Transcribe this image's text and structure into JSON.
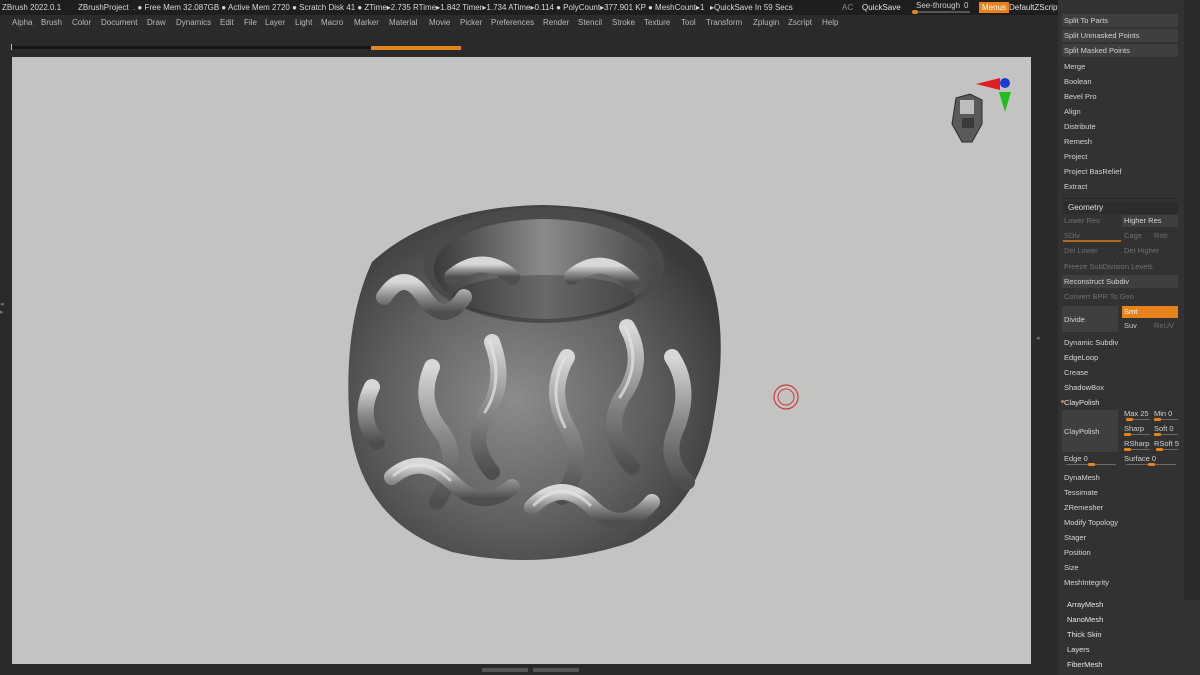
{
  "titlebar": {
    "app": "ZBrush 2022.0.1",
    "project": "ZBrushProject",
    "stats": ". ● Free Mem 32.087GB ● Active Mem 2720 ● Scratch Disk 41 ● ZTime▸2.735 RTime▸1.842 Timer▸1.734 ATime▸0.114 ● PolyCount▸377.901 KP ● MeshCount▸1",
    "quicksave_timer": "▸QuickSave In 59 Secs",
    "ac": "AC",
    "quicksave": "QuickSave",
    "see_through_label": "See-through",
    "see_through_value": "0",
    "menus": "Menus",
    "default_zscript": "DefaultZScript",
    "window_icons": "◆ ▤ ▣ ▢ — □ ✕"
  },
  "menu": [
    "Alpha",
    "Brush",
    "Color",
    "Document",
    "Draw",
    "Dynamics",
    "Edit",
    "File",
    "Layer",
    "Light",
    "Macro",
    "Marker",
    "Material",
    "Movie",
    "Picker",
    "Preferences",
    "Render",
    "Stencil",
    "Stroke",
    "Texture",
    "Tool",
    "Transform",
    "Zplugin",
    "Zscript",
    "Help"
  ],
  "see_through_level": 0,
  "panel": {
    "top_items": [
      "Split To Parts",
      "Split Unmasked Points",
      "Split Masked Points"
    ],
    "subtool_items": [
      "Merge",
      "Boolean",
      "Bevel Pro",
      "Align",
      "Distribute",
      "Remesh",
      "Project",
      "Project BasRelief",
      "Extract"
    ],
    "geometry": {
      "header": "Geometry",
      "lower_res": "Lower Res",
      "higher_res": "Higher Res",
      "sdiv": "SDiv",
      "cage": "Cage",
      "rstr": "Rstr",
      "del_lower": "Del Lower",
      "del_higher": "Del Higher",
      "freeze": "Freeze SubDivision Levels",
      "reconstruct": "Reconstruct Subdiv",
      "convert_bpr": "Convert BPR To Geo",
      "divide": "Divide",
      "smt": "Smt",
      "suv": "Suv",
      "reuv": "ReUV",
      "dynamic_subdiv": "Dynamic Subdiv",
      "edgeloop": "EdgeLoop",
      "crease": "Crease",
      "shadowbox": "ShadowBox",
      "claypolish_toggle": "ClayPolish",
      "claypolish_btn": "ClayPolish",
      "max_label": "Max 25",
      "min_label": "Min 0",
      "sharp_label": "Sharp",
      "soft_label": "Soft 0",
      "rsharp_label": "RSharp",
      "rsoft_label": "RSoft 5",
      "edge_label": "Edge 0",
      "surface_label": "Surface 0",
      "more": [
        "DynaMesh",
        "Tessimate",
        "ZRemesher",
        "Modify Topology",
        "Stager",
        "Position",
        "Size",
        "MeshIntegrity"
      ]
    },
    "bottom_items": [
      "ArrayMesh",
      "NanoMesh",
      "Thick Skin",
      "Layers",
      "FiberMesh"
    ]
  },
  "colors": {
    "accent": "#e8821a",
    "viewport": "#c3c3c1",
    "panel": "#323232"
  }
}
